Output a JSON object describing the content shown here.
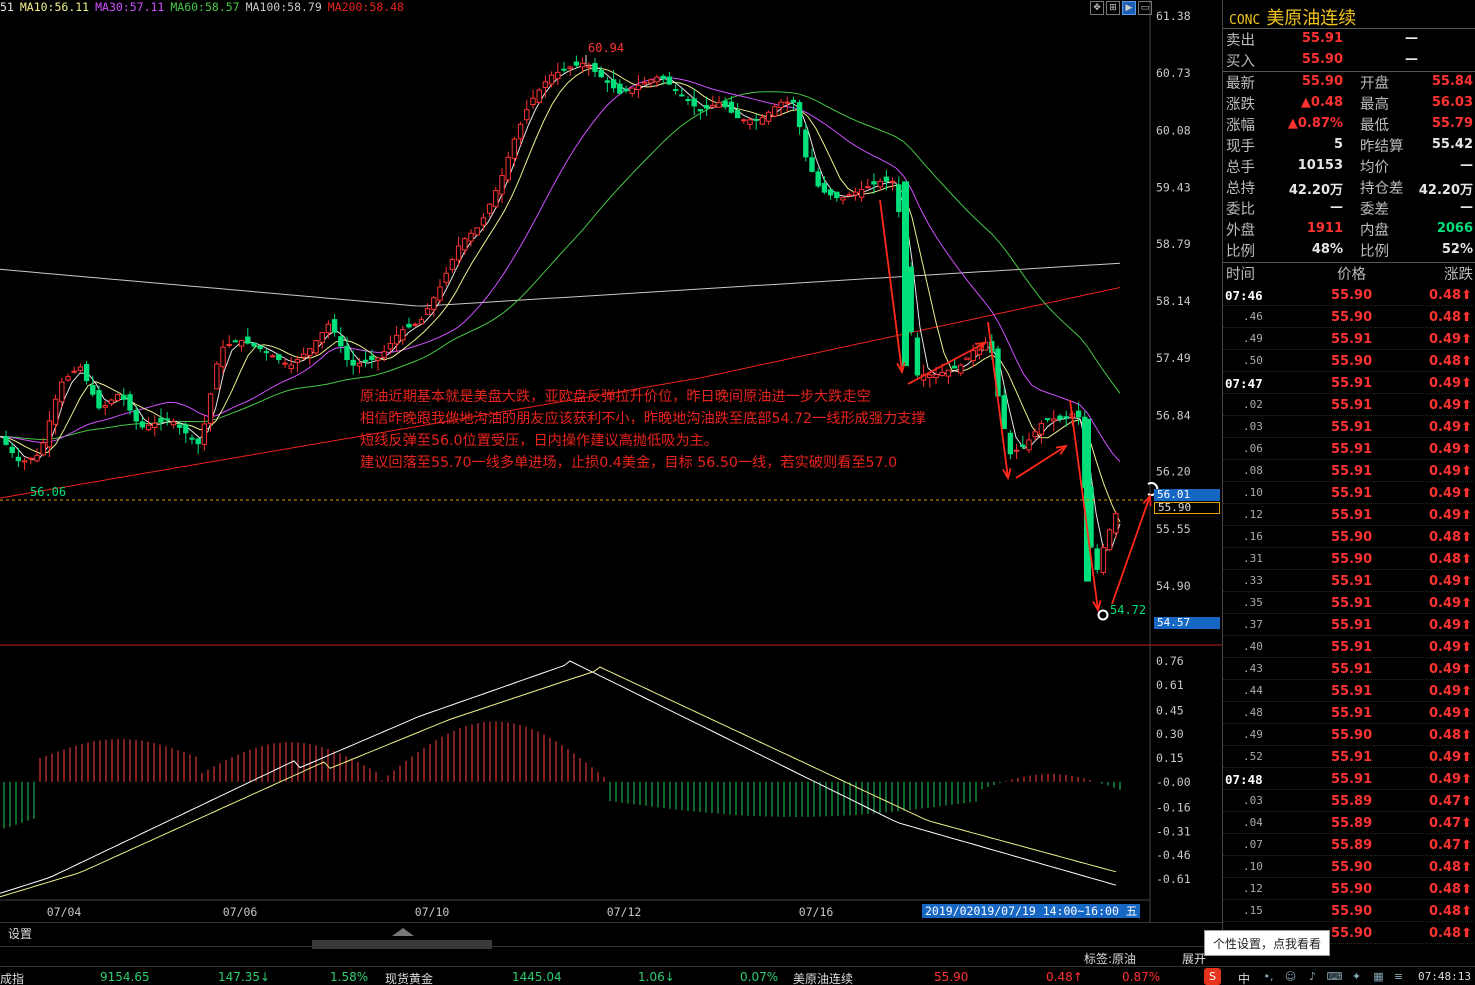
{
  "legend": [
    {
      "text": "51",
      "color": "#e6e6e6"
    },
    {
      "text": "MA10:56.11",
      "color": "#f0f08c"
    },
    {
      "text": "MA30:57.11",
      "color": "#d050ff"
    },
    {
      "text": "MA60:58.57",
      "color": "#46c846"
    },
    {
      "text": "MA100:58.79",
      "color": "#c8c8c8"
    },
    {
      "text": "MA200:58.48",
      "color": "#e8231c"
    }
  ],
  "price_axis": [
    "61.38",
    "60.73",
    "60.08",
    "59.43",
    "58.79",
    "58.14",
    "57.49",
    "56.84",
    "56.20",
    "55.55",
    "54.90"
  ],
  "macd_axis": [
    "0.76",
    "0.61",
    "0.45",
    "0.30",
    "0.15",
    "-0.00",
    "-0.16",
    "-0.31",
    "-0.46",
    "-0.61"
  ],
  "date_axis": [
    "07/04",
    "07/06",
    "07/10",
    "07/12",
    "07/16"
  ],
  "chart_labels": {
    "high": "60.94",
    "low": "54.72",
    "left_low": "56.06"
  },
  "price_tags": {
    "current_blue": "56.01",
    "current_outline": "55.90",
    "low_blue": "54.57"
  },
  "time_tag": "2019/07/19 14:00~16:00 五",
  "time_tag_cut": "2019/0",
  "annotation": [
    "原油近期基本就是美盘大跌，亚欧盘反弹拉升价位，昨日晚间原油进一步大跌走空",
    "相信昨晚跟我做地沟油的朋友应该获利不小，昨晚地沟油跌至底部54.72一线形成强力支撑",
    "短线反弹至56.0位置受压，日内操作建议高抛低吸为主。",
    "建议回落至55.70一线多单进场，止损0.4美金，目标 56.50一线，若实破则看至57.0"
  ],
  "bottom": {
    "settings": "设置",
    "tag_label": "标签:原油",
    "expand": "展开",
    "tooltip": "个性设置，点我看看"
  },
  "quote": {
    "code": "CONC",
    "name": "美原油连续",
    "sell": {
      "label": "卖出",
      "price": "55.91",
      "vol": "—"
    },
    "buy": {
      "label": "买入",
      "price": "55.90",
      "vol": "—"
    },
    "rows": [
      {
        "l1": "最新",
        "v1": "55.90",
        "c1": "red",
        "l2": "开盘",
        "v2": "55.84",
        "c2": "red"
      },
      {
        "l1": "涨跌",
        "v1": "▲0.48",
        "c1": "red",
        "l2": "最高",
        "v2": "56.03",
        "c2": "red"
      },
      {
        "l1": "涨幅",
        "v1": "▲0.87%",
        "c1": "red",
        "l2": "最低",
        "v2": "55.79",
        "c2": "red"
      },
      {
        "l1": "现手",
        "v1": "5",
        "c1": "white",
        "l2": "昨结算",
        "v2": "55.42",
        "c2": "white"
      },
      {
        "l1": "总手",
        "v1": "10153",
        "c1": "white",
        "l2": "均价",
        "v2": "—",
        "c2": "white"
      },
      {
        "l1": "总持",
        "v1": "42.20万",
        "c1": "white",
        "l2": "持仓差",
        "v2": "42.20万",
        "c2": "white"
      },
      {
        "l1": "委比",
        "v1": "—",
        "c1": "white",
        "l2": "委差",
        "v2": "—",
        "c2": "white"
      },
      {
        "l1": "外盘",
        "v1": "1911",
        "c1": "red",
        "l2": "内盘",
        "v2": "2066",
        "c2": "green"
      },
      {
        "l1": "比例",
        "v1": "48%",
        "c1": "white",
        "l2": "比例",
        "v2": "52%",
        "c2": "white"
      }
    ]
  },
  "ts_header": {
    "time": "时间",
    "price": "价格",
    "change": "涨跌"
  },
  "ticks": [
    {
      "t": "07:46",
      "major": true,
      "p": "55.90",
      "c": "0.48"
    },
    {
      "t": ".46",
      "major": false,
      "p": "55.90",
      "c": "0.48"
    },
    {
      "t": ".49",
      "major": false,
      "p": "55.91",
      "c": "0.49"
    },
    {
      "t": ".50",
      "major": false,
      "p": "55.90",
      "c": "0.48"
    },
    {
      "t": "07:47",
      "major": true,
      "p": "55.91",
      "c": "0.49"
    },
    {
      "t": ".02",
      "major": false,
      "p": "55.91",
      "c": "0.49"
    },
    {
      "t": ".03",
      "major": false,
      "p": "55.91",
      "c": "0.49"
    },
    {
      "t": ".06",
      "major": false,
      "p": "55.91",
      "c": "0.49"
    },
    {
      "t": ".08",
      "major": false,
      "p": "55.91",
      "c": "0.49"
    },
    {
      "t": ".10",
      "major": false,
      "p": "55.91",
      "c": "0.49"
    },
    {
      "t": ".12",
      "major": false,
      "p": "55.91",
      "c": "0.49"
    },
    {
      "t": ".16",
      "major": false,
      "p": "55.90",
      "c": "0.48"
    },
    {
      "t": ".31",
      "major": false,
      "p": "55.90",
      "c": "0.48"
    },
    {
      "t": ".33",
      "major": false,
      "p": "55.91",
      "c": "0.49"
    },
    {
      "t": ".35",
      "major": false,
      "p": "55.91",
      "c": "0.49"
    },
    {
      "t": ".37",
      "major": false,
      "p": "55.91",
      "c": "0.49"
    },
    {
      "t": ".40",
      "major": false,
      "p": "55.91",
      "c": "0.49"
    },
    {
      "t": ".43",
      "major": false,
      "p": "55.91",
      "c": "0.49"
    },
    {
      "t": ".44",
      "major": false,
      "p": "55.91",
      "c": "0.49"
    },
    {
      "t": ".48",
      "major": false,
      "p": "55.91",
      "c": "0.49"
    },
    {
      "t": ".49",
      "major": false,
      "p": "55.90",
      "c": "0.48"
    },
    {
      "t": ".52",
      "major": false,
      "p": "55.91",
      "c": "0.49"
    },
    {
      "t": "07:48",
      "major": true,
      "p": "55.91",
      "c": "0.49"
    },
    {
      "t": ".03",
      "major": false,
      "p": "55.89",
      "c": "0.47"
    },
    {
      "t": ".04",
      "major": false,
      "p": "55.89",
      "c": "0.47"
    },
    {
      "t": ".07",
      "major": false,
      "p": "55.89",
      "c": "0.47"
    },
    {
      "t": ".10",
      "major": false,
      "p": "55.90",
      "c": "0.48"
    },
    {
      "t": ".12",
      "major": false,
      "p": "55.90",
      "c": "0.48"
    },
    {
      "t": ".15",
      "major": false,
      "p": "55.90",
      "c": "0.48"
    },
    {
      "t": "",
      "major": false,
      "p": "55.90",
      "c": "0.48"
    }
  ],
  "status": {
    "idx_label": "成指",
    "idx_val": "9154.65",
    "idx_chg": "147.35↓",
    "idx_pct": "1.58%",
    "gold_label": "现货黄金",
    "gold_val": "1445.04",
    "gold_chg": "1.06↓",
    "gold_pct": "0.07%",
    "oil_label": "美原油连续",
    "oil_val": "55.90",
    "oil_chg": "0.48↑",
    "oil_pct": "0.87%",
    "clock": "07:48:13",
    "ime": "中"
  },
  "colors": {
    "up": "#ff3232",
    "down": "#00e07a",
    "accent_blue": "#1666c4"
  }
}
